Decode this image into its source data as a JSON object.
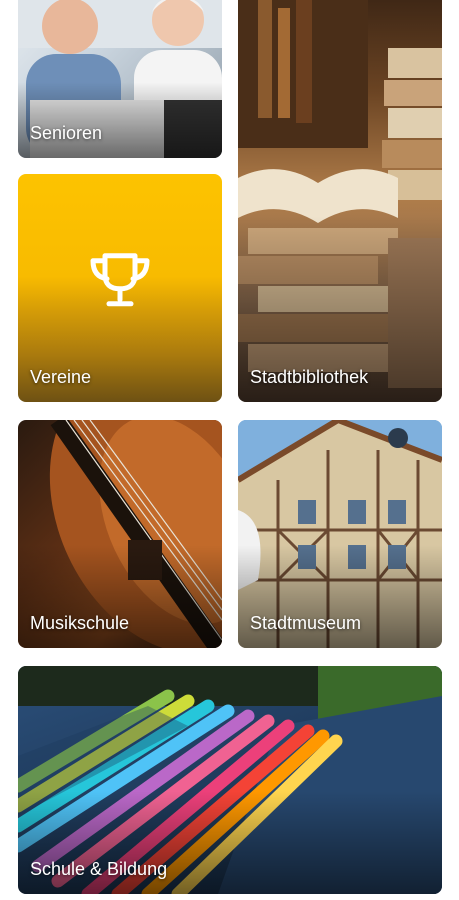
{
  "tiles": {
    "senioren": {
      "label": "Senioren",
      "image_icon": "seniors-photo"
    },
    "vereine": {
      "label": "Vereine",
      "icon": "trophy-icon",
      "accent": "#fdc300"
    },
    "stadtbibliothek": {
      "label": "Stadtbibliothek",
      "image_icon": "library-books-photo"
    },
    "musikschule": {
      "label": "Musikschule",
      "image_icon": "violin-photo"
    },
    "stadtmuseum": {
      "label": "Stadtmuseum",
      "image_icon": "half-timbered-house-photo"
    },
    "schule_bildung": {
      "label": "Schule & Bildung",
      "image_icon": "colored-pencils-photo"
    }
  }
}
